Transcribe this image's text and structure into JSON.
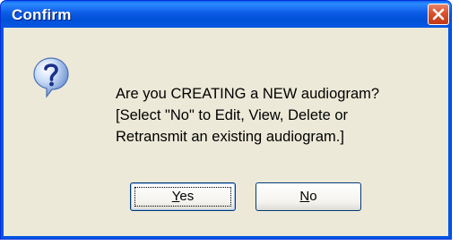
{
  "window": {
    "title": "Confirm"
  },
  "dialog": {
    "message_lines": [
      "Are you CREATING a NEW audiogram?",
      "[Select \"No\" to Edit, View, Delete or",
      "Retransmit an existing audiogram.]"
    ],
    "icon": "question-icon"
  },
  "buttons": {
    "yes": {
      "mnemonic": "Y",
      "rest": "es"
    },
    "no": {
      "mnemonic": "N",
      "rest": "o"
    }
  },
  "colors": {
    "titlebar_blue": "#0055e5",
    "dialog_face": "#ece9d8",
    "close_red": "#d9502b"
  }
}
